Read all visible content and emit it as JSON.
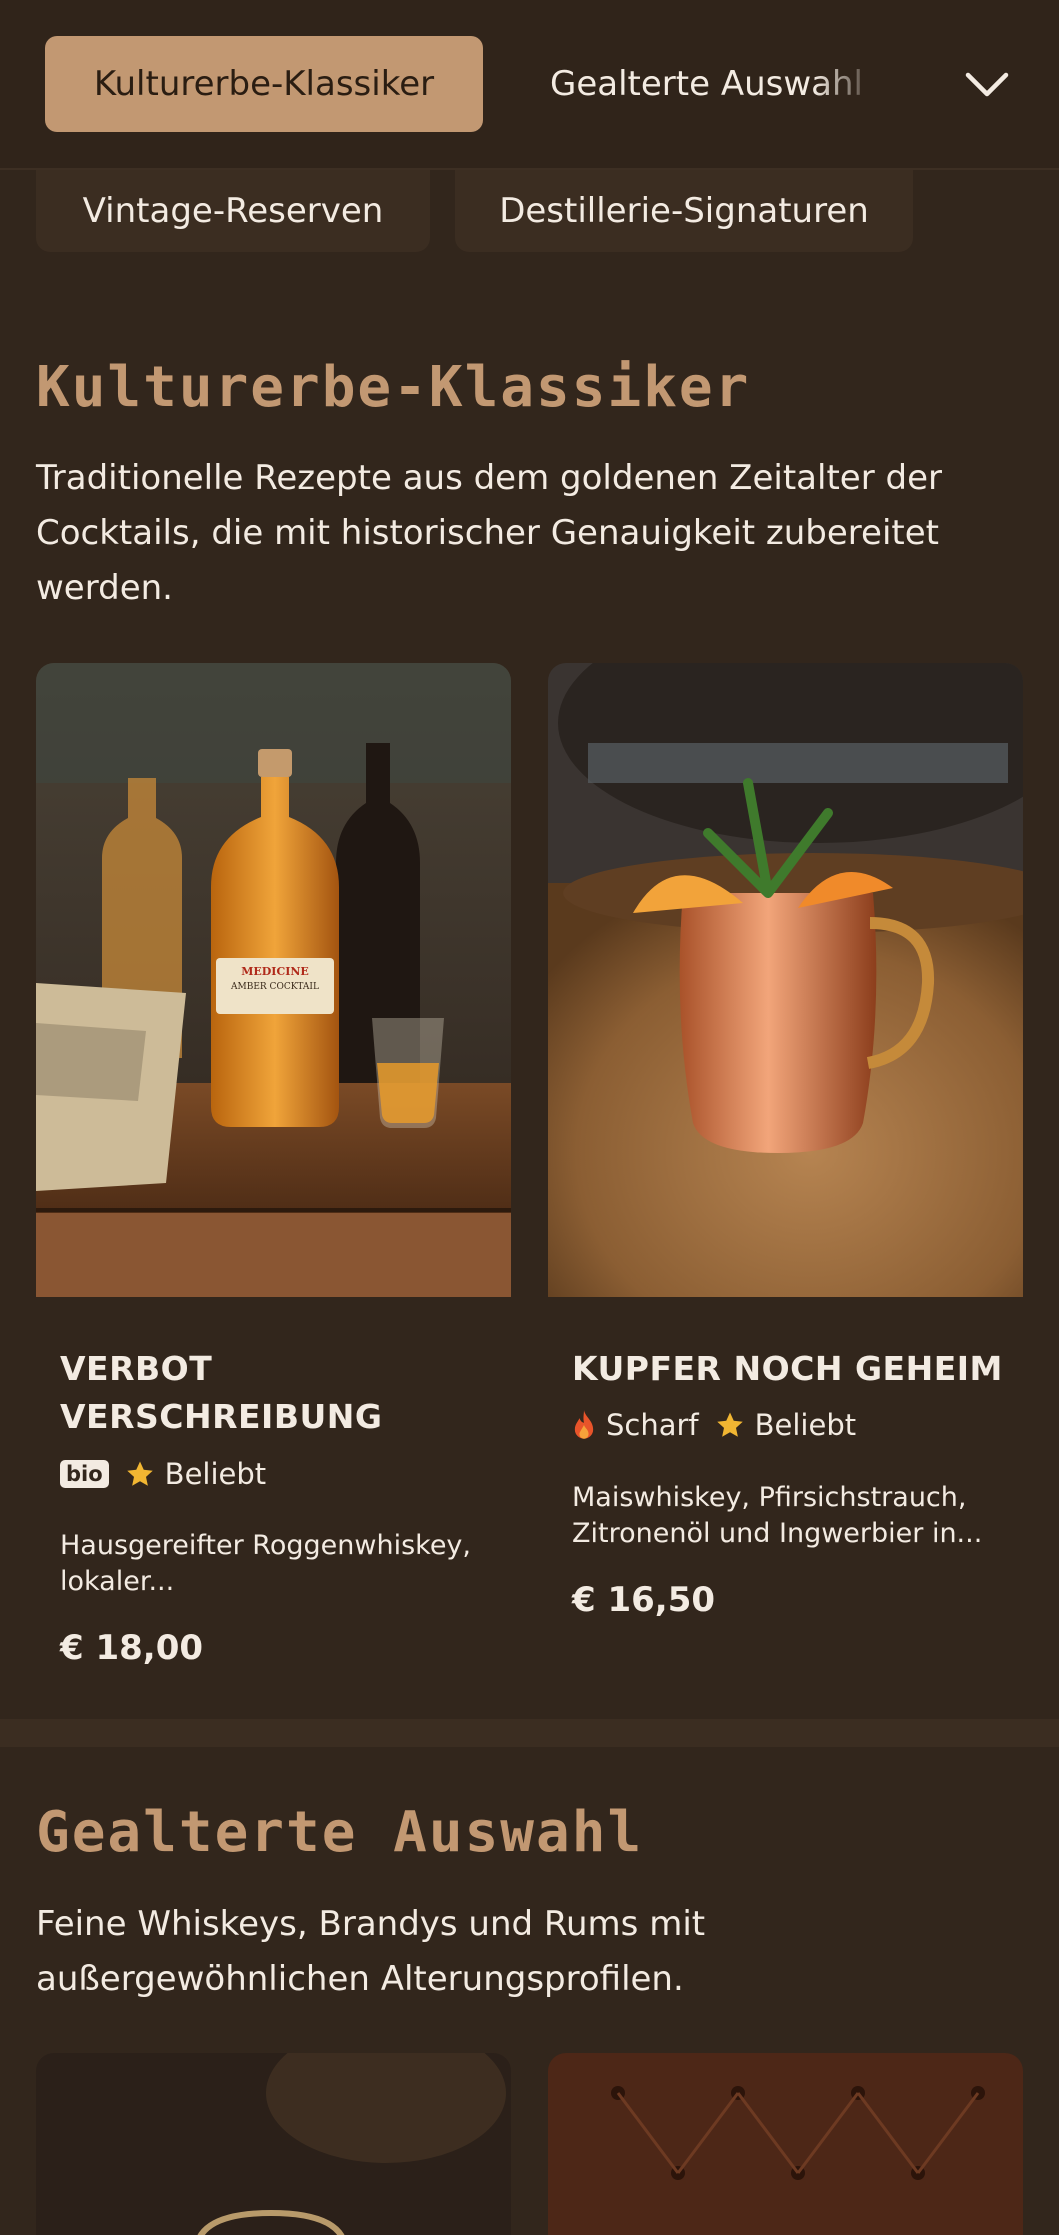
{
  "nav": {
    "tabs": [
      "Kulturerbe-Klassiker",
      "Gealterte Auswahl",
      "Vintage-Reserven",
      "Destillerie-Signaturen"
    ],
    "active_index": 0,
    "expand_icon": "chevron-down-icon"
  },
  "sections": [
    {
      "title": "Kulturerbe-Klassiker",
      "description": "Traditionelle Rezepte aus dem goldenen Zeitalter der Cocktails, die mit historischer Genauigkeit zubereitet werden.",
      "items": [
        {
          "name": "VERBOT VERSCHREIBUNG",
          "tags": [
            {
              "icon": "bio-badge",
              "label": "bio"
            },
            {
              "icon": "star-icon",
              "label": "Beliebt"
            }
          ],
          "description": "Hausgereifter Roggenwhiskey, lokaler...",
          "price": "€ 18,00",
          "image_label_lines": [
            "MEDICINE",
            "AMBER COCKTAIL"
          ]
        },
        {
          "name": "KUPFER NOCH GEHEIM",
          "tags": [
            {
              "icon": "flame-icon",
              "label": "Scharf"
            },
            {
              "icon": "star-icon",
              "label": "Beliebt"
            }
          ],
          "description": "Maiswhiskey, Pfirsichstrauch, Zitronenöl und Ingwerbier in...",
          "price": "€ 16,50"
        }
      ]
    },
    {
      "title": "Gealterte Auswahl",
      "description": "Feine Whiskeys, Brandys und Rums mit außergewöhnlichen Alterungsprofilen."
    }
  ],
  "colors": {
    "background": "#32261c",
    "accent": "#c29872",
    "star": "#f2b632",
    "flame": "#e8542a"
  }
}
